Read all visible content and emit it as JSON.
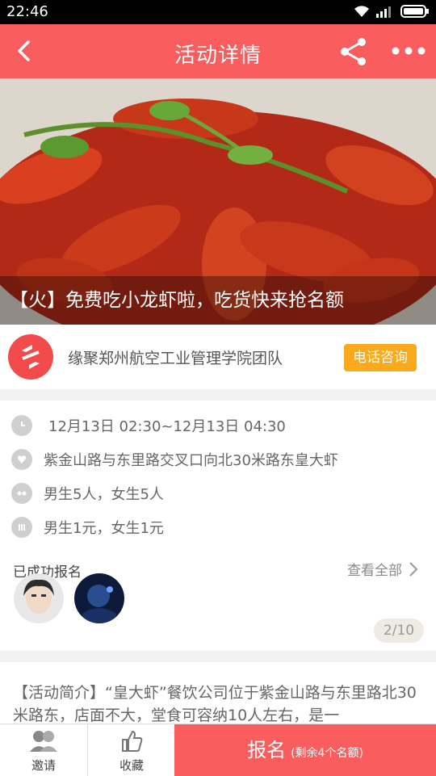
{
  "statusbar": {
    "time": "22:46"
  },
  "navbar": {
    "title": "活动详情"
  },
  "banner": {
    "caption": "【火】免费吃小龙虾啦，吃货快来抢名额"
  },
  "organizer": {
    "name": "缘聚郑州航空工业管理学院团队",
    "call_label": "电话咨询"
  },
  "details": {
    "time": "12月13日 02:30~12月13日 04:30",
    "address": "紫金山路与东里路交叉口向北30米路东皇大虾",
    "quota": "男生5人，女生5人",
    "fee": "男生1元，女生1元"
  },
  "enrolled": {
    "label": "已成功报名",
    "view_all": "查看全部",
    "counter": "2/10"
  },
  "intro": {
    "text": "【活动简介】“皇大虾”餐饮公司位于紫金山路与东里路北30米路东，店面不大，堂食可容纳10人左右，是一"
  },
  "bottombar": {
    "invite_label": "邀请",
    "favorite_label": "收藏",
    "signup_label": "报名",
    "signup_sub": "(剩余4个名额)"
  },
  "colors": {
    "primary": "#f95d5d",
    "accent": "#f8a91c"
  }
}
